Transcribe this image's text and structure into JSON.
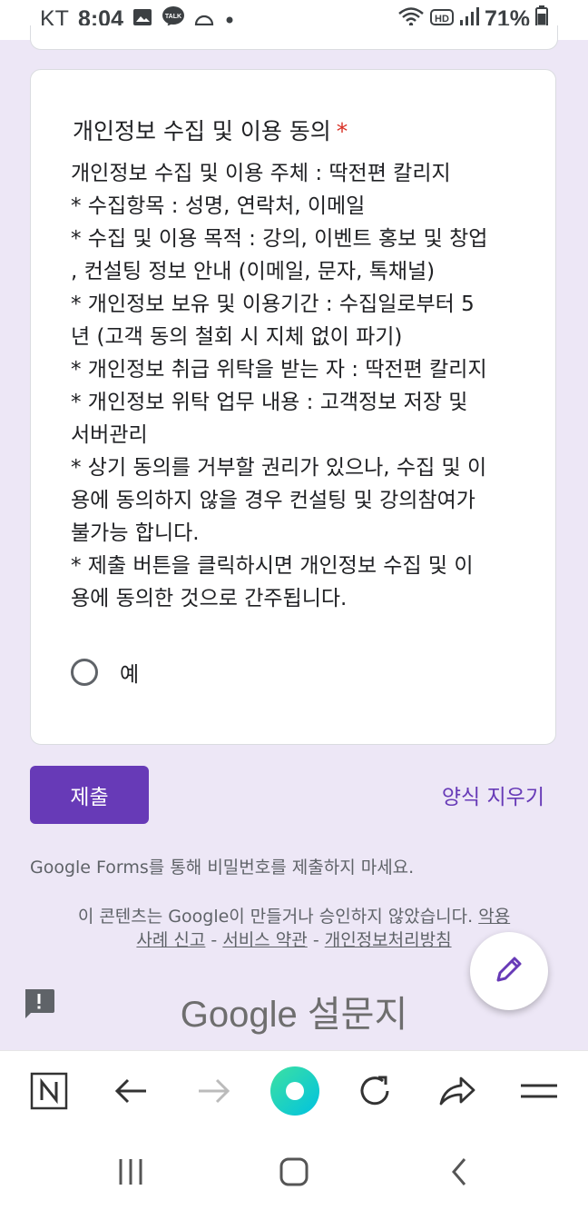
{
  "status_bar": {
    "carrier": "KT",
    "time": "8:04",
    "battery": "71%",
    "hd_label": "HD"
  },
  "question": {
    "title": "개인정보 수집 및 이용 동의",
    "required_mark": "*",
    "description_lines": [
      " 개인정보 수집 및 이용 주체 : 딱전편 칼리지",
      "* 수집항목 : 성명, 연락처, 이메일",
      "* 수집 및 이용 목적 : 강의, 이벤트 홍보 및 창업",
      ", 컨설팅 정보 안내 (이메일, 문자, 톡채널)",
      "* 개인정보 보유 및 이용기간 : 수집일로부터 5",
      "년 (고객 동의 철회 시 지체 없이 파기)",
      "* 개인정보 취급 위탁을 받는 자 : 딱전편 칼리지",
      "* 개인정보 위탁 업무 내용 : 고객정보 저장 및",
      "서버관리",
      "* 상기 동의를 거부할 권리가 있으나, 수집 및 이",
      "용에 동의하지 않을 경우 컨설팅 및 강의참여가",
      "불가능 합니다.",
      "* 제출 버튼을 클릭하시면 개인정보 수집 및 이",
      "용에 동의한 것으로 간주됩니다."
    ],
    "option_label": "예"
  },
  "actions": {
    "submit_label": "제출",
    "clear_label": "양식 지우기"
  },
  "footer": {
    "password_warning": "Google Forms를 통해 비밀번호를 제출하지 마세요.",
    "disclaimer_text": "이 콘텐츠는 Google이 만들거나 승인하지 않았습니다. ",
    "abuse_link_1": "악용",
    "abuse_link_2": "사례 신고",
    "sep1": " - ",
    "terms_link": "서비스 약관",
    "sep2": " - ",
    "privacy_link": "개인정보처리방침",
    "brand_google": "Google",
    "brand_forms": " 설문지"
  },
  "colors": {
    "accent": "#673ab7",
    "background": "#ede7f6",
    "required": "#d93025"
  },
  "icons": {
    "fab": "pencil-icon",
    "report": "report-icon",
    "browser_toolbar": [
      "naver-n-icon",
      "back-arrow-icon",
      "forward-arrow-icon",
      "green-home-icon",
      "refresh-icon",
      "share-icon",
      "menu-icon"
    ],
    "system_nav": [
      "recent-apps-icon",
      "home-icon",
      "back-icon"
    ]
  }
}
